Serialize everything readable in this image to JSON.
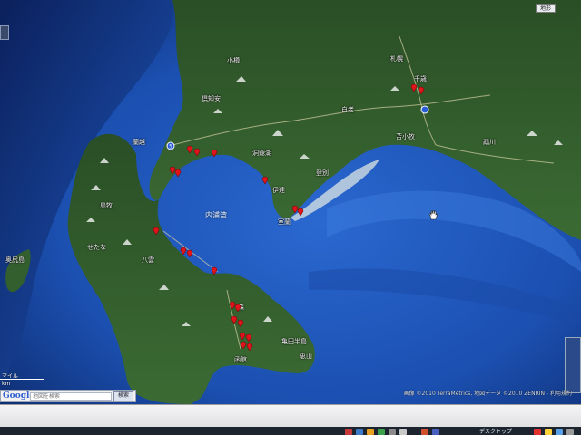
{
  "map": {
    "water_labels": {
      "bay": "内浦湾"
    },
    "place_labels": {
      "isl": "奥尻島",
      "otaru": "小樽",
      "sapporo": "札幌",
      "kutchan": "倶知安",
      "shimamaki": "島牧",
      "rankoshi": "蘭越",
      "toya": "洞爺湖",
      "date": "伊達",
      "muroran": "室蘭",
      "tomakomai": "苫小牧",
      "setana": "せたな",
      "yakumo": "八雲",
      "mori": "森",
      "hakodate": "函館",
      "esan": "恵山",
      "kameda": "亀田半島",
      "chitose": "千歳",
      "mukawa": "鵡川",
      "noboribetsu": "登別",
      "shiraoi": "白老"
    },
    "route_shields": {
      "r5": "5"
    },
    "markers": [
      {
        "id": "m1"
      },
      {
        "id": "m2"
      },
      {
        "id": "m3"
      },
      {
        "id": "m4"
      },
      {
        "id": "m5"
      },
      {
        "id": "m6"
      },
      {
        "id": "m7"
      },
      {
        "id": "m8"
      },
      {
        "id": "m9"
      },
      {
        "id": "m10"
      },
      {
        "id": "m11"
      },
      {
        "id": "m12"
      },
      {
        "id": "m13"
      },
      {
        "id": "m14"
      },
      {
        "id": "m15"
      },
      {
        "id": "m16"
      },
      {
        "id": "m17"
      },
      {
        "id": "m18"
      },
      {
        "id": "m19"
      },
      {
        "id": "m20"
      },
      {
        "id": "m21"
      },
      {
        "id": "m22"
      }
    ],
    "top_control_label": "地形",
    "attribution": "画像 ©2010 TerraMetrics, 地図データ ©2010 ZENRIN - 利用規約",
    "scale": {
      "top_label": "マイル",
      "bottom_label": "km"
    }
  },
  "search": {
    "logo": "Google",
    "placeholder": "地図を検索",
    "button_label": "検索"
  },
  "taskbar": {
    "desktop_label": "デスクトップ"
  },
  "colors": {
    "ocean": "#1b4fb0",
    "land": "#2f5a2a",
    "marker": "#e0141a"
  }
}
